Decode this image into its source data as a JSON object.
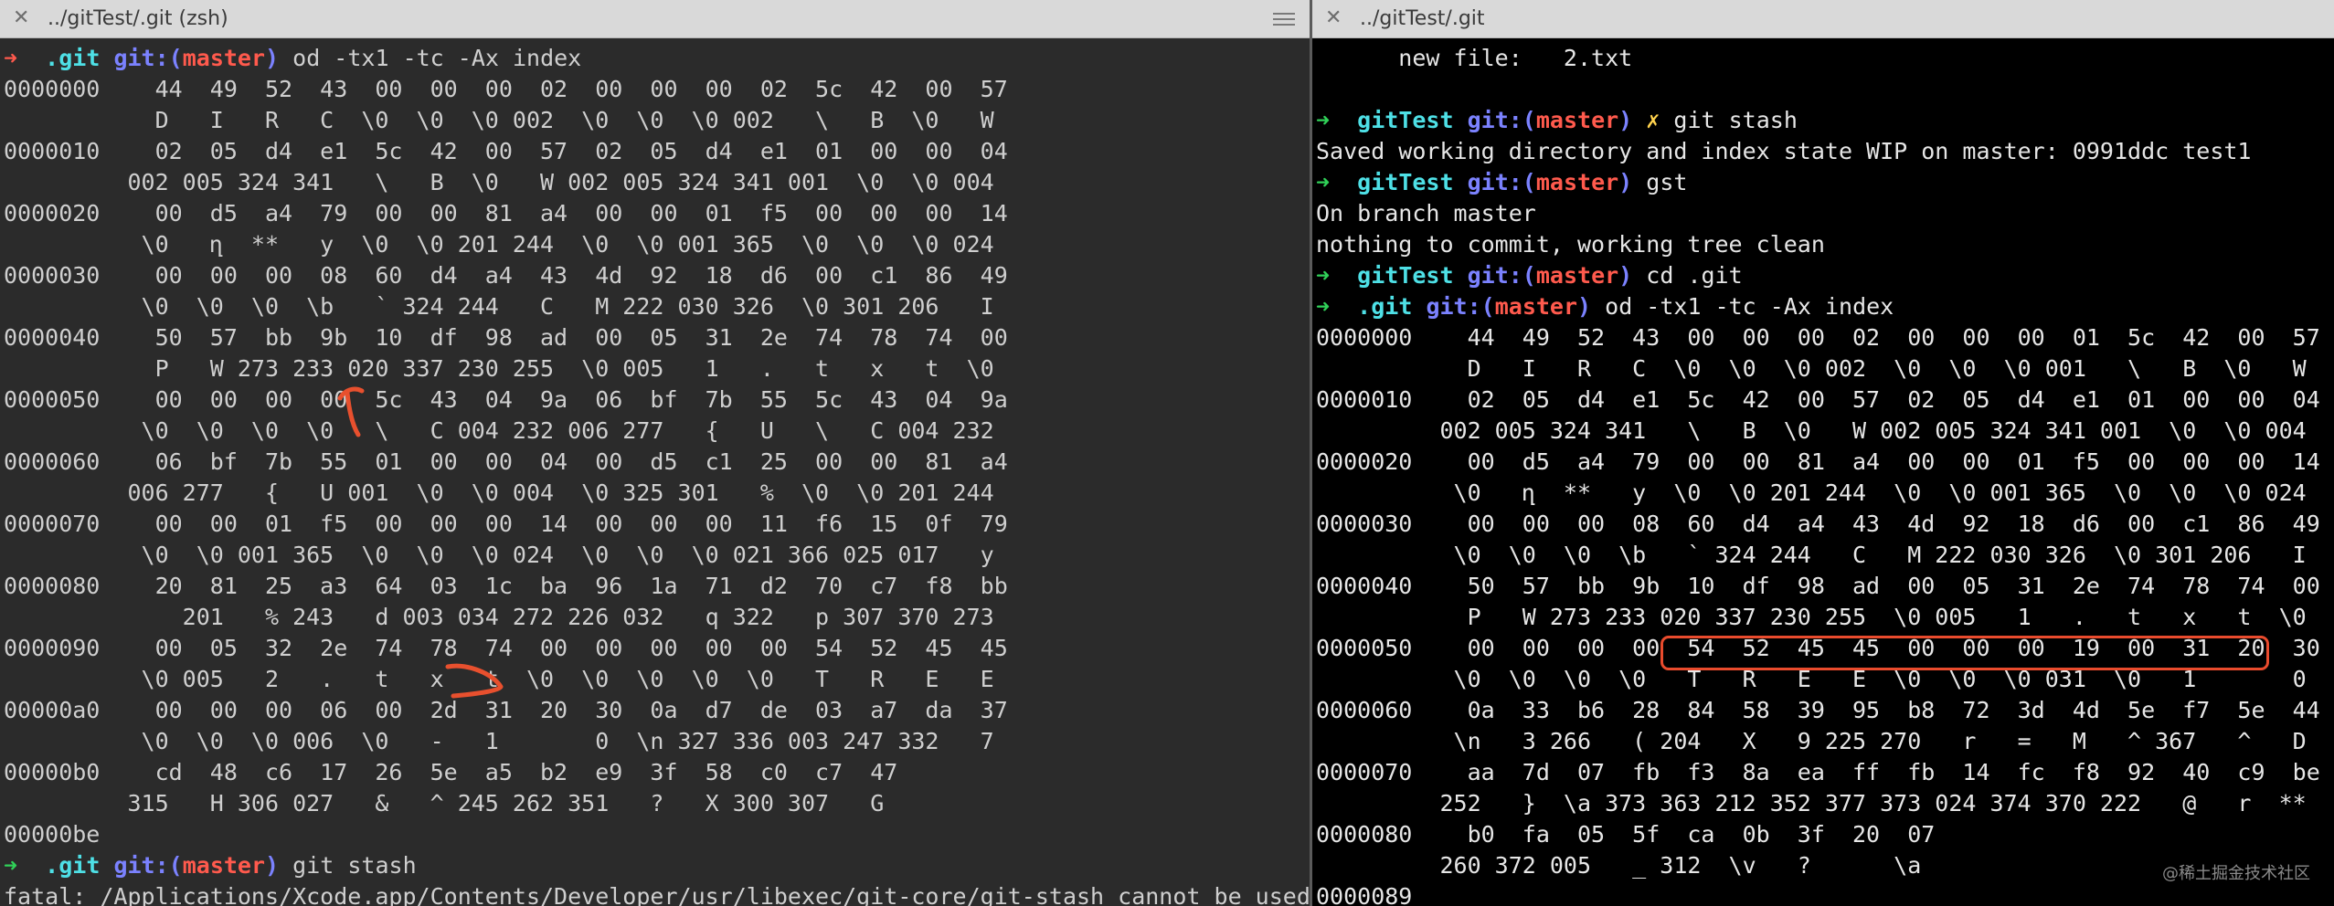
{
  "left_pane": {
    "tab_title": "../gitTest/.git (zsh)",
    "close_icon": "close-icon",
    "menu_icon": "hamburger-menu-icon",
    "prompt": {
      "dir": ".git",
      "git": "git:(",
      "branch": "master",
      "close": ")",
      "cmd": "od -tx1 -tc -Ax index"
    },
    "dump": [
      "0000000    44  49  52  43  00  00  00  02  00  00  00  02  5c  42  00  57",
      "           D   I   R   C  \\0  \\0  \\0 002  \\0  \\0  \\0 002   \\   B  \\0   W",
      "0000010    02  05  d4  e1  5c  42  00  57  02  05  d4  e1  01  00  00  04",
      "         002 005 324 341   \\   B  \\0   W 002 005 324 341 001  \\0  \\0 004",
      "0000020    00  d5  a4  79  00  00  81  a4  00  00  01  f5  00  00  00  14",
      "          \\0   ղ  **   y  \\0  \\0 201 244  \\0  \\0 001 365  \\0  \\0  \\0 024",
      "0000030    00  00  00  08  60  d4  a4  43  4d  92  18  d6  00  c1  86  49",
      "          \\0  \\0  \\0  \\b   ` 324 244   C   M 222 030 326  \\0 301 206   I",
      "0000040    50  57  bb  9b  10  df  98  ad  00  05  31  2e  74  78  74  00",
      "           P   W 273 233 020 337 230 255  \\0 005   1   .   t   x   t  \\0",
      "0000050    00  00  00  00  5c  43  04  9a  06  bf  7b  55  5c  43  04  9a",
      "          \\0  \\0  \\0  \\0   \\   C 004 232 006 277   {   U   \\   C 004 232",
      "0000060    06  bf  7b  55  01  00  00  04  00  d5  c1  25  00  00  81  a4",
      "         006 277   {   U 001  \\0  \\0 004  \\0 325 301   %  \\0  \\0 201 244",
      "0000070    00  00  01  f5  00  00  00  14  00  00  00  11  f6  15  0f  79",
      "          \\0  \\0 001 365  \\0  \\0  \\0 024  \\0  \\0  \\0 021 366 025 017   y",
      "0000080    20  81  25  a3  64  03  1c  ba  96  1a  71  d2  70  c7  f8  bb",
      "             201   % 243   d 003 034 272 226 032   q 322   p 307 370 273",
      "0000090    00  05  32  2e  74  78  74  00  00  00  00  00  54  52  45  45",
      "          \\0 005   2   .   t   x   t  \\0  \\0  \\0  \\0  \\0   T   R   E   E",
      "00000a0    00  00  00  06  00  2d  31  20  30  0a  d7  de  03  a7  da  37",
      "          \\0  \\0  \\0 006  \\0   -   1       0  \\n 327 336 003 247 332   7",
      "00000b0    cd  48  c6  17  26  5e  a5  b2  e9  3f  58  c0  c7  47",
      "         315   H 306 027   &   ^ 245 262 351   ?   X 300 307   G",
      "00000be"
    ],
    "prompt2": {
      "dir": ".git",
      "git": "git:(",
      "branch": "master",
      "close": ")",
      "cmd": "git stash"
    },
    "error": "fatal: /Applications/Xcode.app/Contents/Developer/usr/libexec/git-core/git-stash cannot be used witho"
  },
  "right_pane": {
    "tab_title": "../gitTest/.git",
    "close_icon": "close-icon",
    "new_file_line": "      new file:   2.txt",
    "p1": {
      "dir": "gitTest",
      "git": "git:(",
      "branch": "master",
      "close": ")",
      "dirty": "✗",
      "cmd": "git stash"
    },
    "saved": "Saved working directory and index state WIP on master: 0991ddc test1",
    "p2": {
      "dir": "gitTest",
      "git": "git:(",
      "branch": "master",
      "close": ")",
      "cmd": "gst"
    },
    "status1": "On branch master",
    "status2": "nothing to commit, working tree clean",
    "p3": {
      "dir": "gitTest",
      "git": "git:(",
      "branch": "master",
      "close": ")",
      "cmd": "cd .git"
    },
    "p4": {
      "dir": ".git",
      "git": "git:(",
      "branch": "master",
      "close": ")",
      "cmd": "od -tx1 -tc -Ax index"
    },
    "dump": [
      "0000000    44  49  52  43  00  00  00  02  00  00  00  01  5c  42  00  57",
      "           D   I   R   C  \\0  \\0  \\0 002  \\0  \\0  \\0 001   \\   B  \\0   W",
      "0000010    02  05  d4  e1  5c  42  00  57  02  05  d4  e1  01  00  00  04",
      "         002 005 324 341   \\   B  \\0   W 002 005 324 341 001  \\0  \\0 004",
      "0000020    00  d5  a4  79  00  00  81  a4  00  00  01  f5  00  00  00  14",
      "          \\0   ղ  **   y  \\0  \\0 201 244  \\0  \\0 001 365  \\0  \\0  \\0 024",
      "0000030    00  00  00  08  60  d4  a4  43  4d  92  18  d6  00  c1  86  49",
      "          \\0  \\0  \\0  \\b   ` 324 244   C   M 222 030 326  \\0 301 206   I",
      "0000040    50  57  bb  9b  10  df  98  ad  00  05  31  2e  74  78  74  00",
      "           P   W 273 233 020 337 230 255  \\0 005   1   .   t   x   t  \\0",
      "0000050    00  00  00  00  54  52  45  45  00  00  00  19  00  31  20  30",
      "          \\0  \\0  \\0  \\0   T   R   E   E  \\0  \\0  \\0 031  \\0   1       0",
      "0000060    0a  33  b6  28  84  58  39  95  b8  72  3d  4d  5e  f7  5e  44",
      "          \\n   3 266   ( 204   X   9 225 270   r   =   M   ^ 367   ^   D",
      "0000070    aa  7d  07  fb  f3  8a  ea  ff  fb  14  fc  f8  92  40  c9  be",
      "         252   }  \\a 373 363 212 352 377 373 024 374 370 222   @   r  **",
      "0000080    b0  fa  05  5f  ca  0b  3f  20  07",
      "         260 372 005   _ 312  \\v   ?      \\a",
      "0000089"
    ],
    "watermark": "@稀土掘金技术社区"
  }
}
